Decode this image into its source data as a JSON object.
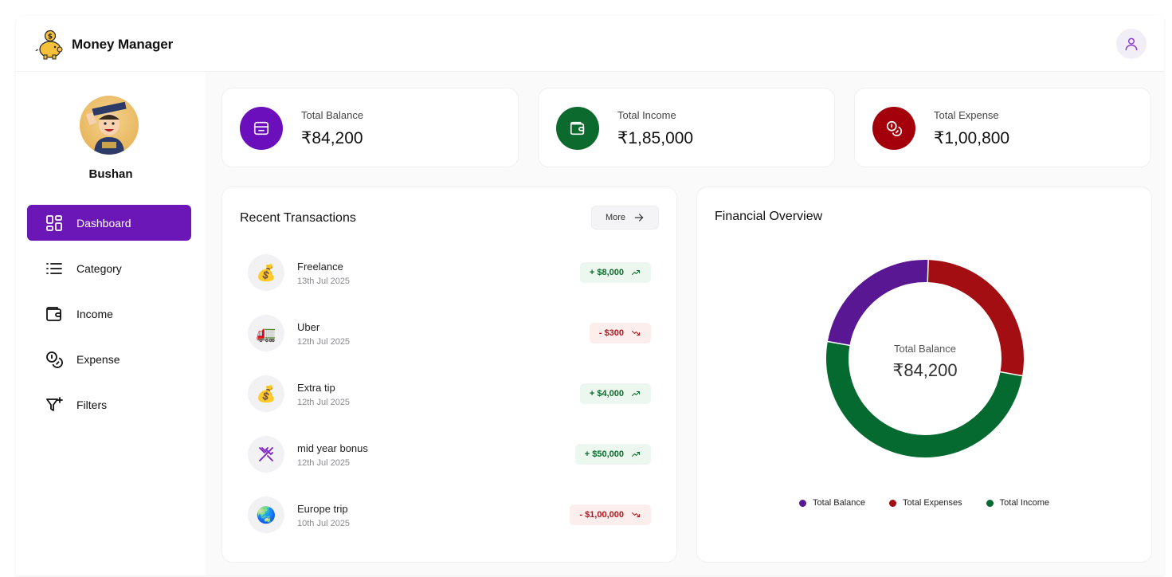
{
  "app": {
    "name": "Money Manager",
    "user_name": "Bushan",
    "accent": "#6b17b8"
  },
  "sidebar": {
    "items": [
      {
        "label": "Dashboard",
        "icon": "dashboard-icon",
        "active": true
      },
      {
        "label": "Category",
        "icon": "list-icon",
        "active": false
      },
      {
        "label": "Income",
        "icon": "wallet-icon",
        "active": false
      },
      {
        "label": "Expense",
        "icon": "coins-icon",
        "active": false
      },
      {
        "label": "Filters",
        "icon": "filter-plus-icon",
        "active": false
      }
    ]
  },
  "stats": {
    "balance": {
      "label": "Total Balance",
      "value": "₹84,200",
      "color": "#6a0fbb",
      "icon": "card-icon"
    },
    "income": {
      "label": "Total Income",
      "value": "₹1,85,000",
      "color": "#0d6a2e",
      "icon": "wallet-icon"
    },
    "expense": {
      "label": "Total Expense",
      "value": "₹1,00,800",
      "color": "#a3000c",
      "icon": "coins-icon"
    }
  },
  "transactions": {
    "title": "Recent Transactions",
    "more_label": "More",
    "items": [
      {
        "name": "Freelance",
        "date": "13th Jul 2025",
        "amount": "+ $8,000",
        "type": "income",
        "icon": "💰"
      },
      {
        "name": "Uber",
        "date": "12th Jul 2025",
        "amount": "- $300",
        "type": "expense",
        "icon": "🚛"
      },
      {
        "name": "Extra tip",
        "date": "12th Jul 2025",
        "amount": "+ $4,000",
        "type": "income",
        "icon": "💰"
      },
      {
        "name": "mid year bonus",
        "date": "12th Jul 2025",
        "amount": "+ $50,000",
        "type": "income",
        "icon": "utensils-icon"
      },
      {
        "name": "Europe trip",
        "date": "10th Jul 2025",
        "amount": "- $1,00,000",
        "type": "expense",
        "icon": "🌏"
      }
    ]
  },
  "chart_data": {
    "type": "pie",
    "title": "Financial Overview",
    "center_label": "Total Balance",
    "center_value": "₹84,200",
    "categories": [
      "Total Balance",
      "Total Expenses",
      "Total Income"
    ],
    "values": [
      84200,
      100800,
      185000
    ],
    "colors": [
      "#5a1793",
      "#a30e12",
      "#056a2f"
    ],
    "legend_position": "bottom"
  }
}
